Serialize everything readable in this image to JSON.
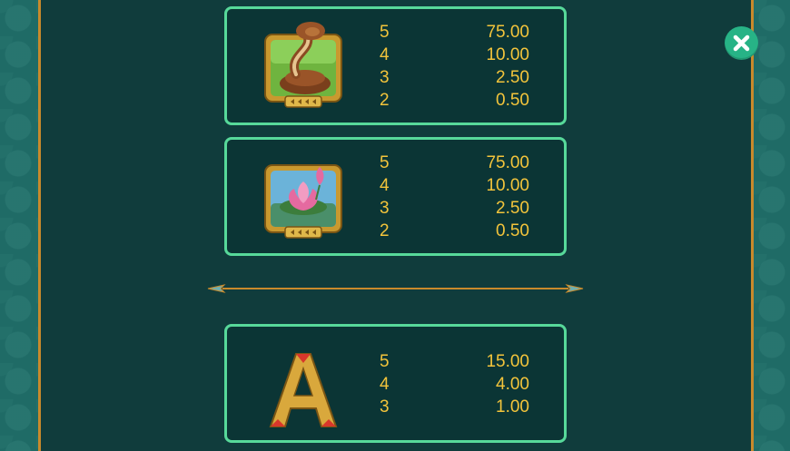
{
  "colors": {
    "background": "#103c3c",
    "side_pattern": "#1f6b66",
    "gold_border": "#c98a2b",
    "card_border": "#57d99a",
    "payout_text": "#f3c43b",
    "close_button": "#27b386"
  },
  "close_button": {
    "icon": "close-icon"
  },
  "paytable": [
    {
      "symbol": "cobra-icon",
      "payouts": [
        {
          "count": "5",
          "value": "75.00"
        },
        {
          "count": "4",
          "value": "10.00"
        },
        {
          "count": "3",
          "value": "2.50"
        },
        {
          "count": "2",
          "value": "0.50"
        }
      ]
    },
    {
      "symbol": "lotus-icon",
      "payouts": [
        {
          "count": "5",
          "value": "75.00"
        },
        {
          "count": "4",
          "value": "10.00"
        },
        {
          "count": "3",
          "value": "2.50"
        },
        {
          "count": "2",
          "value": "0.50"
        }
      ]
    },
    {
      "symbol": "letter-a-icon",
      "payouts": [
        {
          "count": "5",
          "value": "15.00"
        },
        {
          "count": "4",
          "value": "4.00"
        },
        {
          "count": "3",
          "value": "1.00"
        }
      ]
    }
  ]
}
